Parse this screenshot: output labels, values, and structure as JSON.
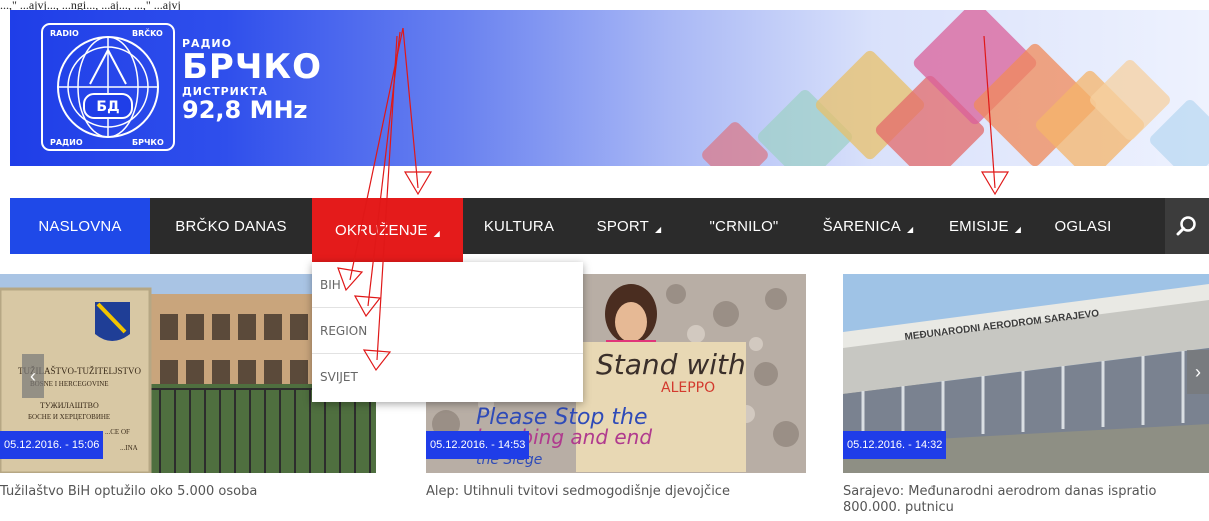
{
  "top_strip_text": "...,\" ...ajvj..., ...ngi..., ...aj..., ...,\" ...ajvj",
  "header": {
    "logo_top_left": "RADIO",
    "logo_top_right": "BRČKO",
    "logo_bottom_left": "РАДИО",
    "logo_bottom_right": "БРЧКО",
    "logo_mark": "БД",
    "name_line1": "РАДИО",
    "name_line2": "БРЧКО",
    "name_line3": "ДИСТРИКТА",
    "frequency": "92,8 MHz"
  },
  "nav": {
    "items": [
      {
        "label": "NASLOVNA",
        "caret": ""
      },
      {
        "label": "BRČKO DANAS",
        "caret": ""
      },
      {
        "label": "OKRUŽENJE",
        "caret": "◢"
      },
      {
        "label": "KULTURA",
        "caret": ""
      },
      {
        "label": "SPORT",
        "caret": "◢"
      },
      {
        "label": "\"CRNILO\"",
        "caret": ""
      },
      {
        "label": "ŠARENICA",
        "caret": "◢"
      },
      {
        "label": "EMISIJE",
        "caret": "◢"
      },
      {
        "label": "OGLASI",
        "caret": ""
      }
    ],
    "search_icon": "search-icon"
  },
  "dropdown": {
    "items": [
      "BIH",
      "REGION",
      "SVIJET"
    ]
  },
  "cards": [
    {
      "date": "05.12.2016. - 15:06",
      "caption": "Tužilaštvo BiH optužilo oko 5.000 osoba",
      "sign_text_1": "TUŽILAŠTVO-TUŽITELJSTVO",
      "sign_text_2": "BOSNE I HERCEGOVINE",
      "sign_text_3": "ТУЖИЛАШТВО",
      "sign_text_4": "БОСНЕ И ХЕРЦЕГОВИНЕ",
      "sign_text_5": "...CE OF",
      "sign_text_6": "...INA"
    },
    {
      "date": "05.12.2016. - 14:53",
      "caption": "Alep: Utihnuli tvitovi sedmogodišnje djevojčice",
      "sign_line1": "Stand with",
      "sign_line2": "ALEPPO",
      "sign_line3": "Please Stop the",
      "sign_line4": "bombing and end",
      "sign_line5": "the Siege"
    },
    {
      "date": "05.12.2016. - 14:32",
      "caption_line1": "Sarajevo: Međunarodni aerodrom danas ispratio",
      "caption_line2": "800.000. putnicu",
      "building_sign": "MEĐUNARODNI AERODROM SARAJEVO"
    }
  ],
  "slider": {
    "prev": "‹",
    "next": "›"
  },
  "colors": {
    "nav_bg": "#2b2b2b",
    "nav_active": "#1f49e8",
    "nav_open": "#e41b1b",
    "date_badge": "#1f3de8",
    "annotation_arrows": "#e01818"
  }
}
